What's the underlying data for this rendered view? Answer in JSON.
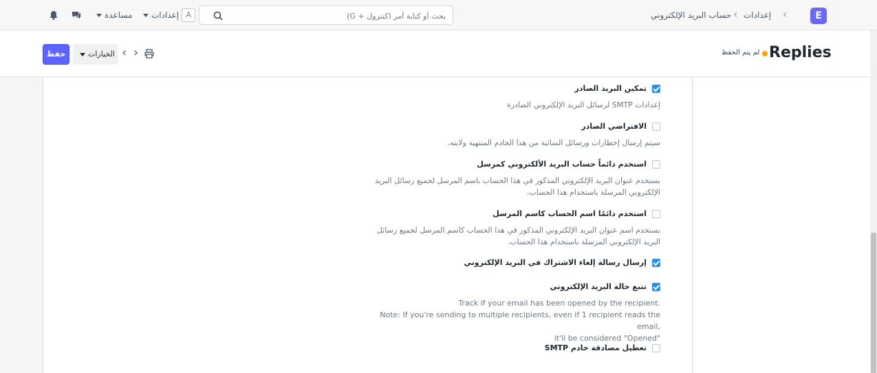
{
  "topbar": {
    "brand_letter": "E",
    "breadcrumb": [
      "إعدادات",
      "حساب البريد الإلكتروني"
    ],
    "search_placeholder": "بحث أو كتابة أمر (كنترول + G)",
    "settings_label": "إعدادات",
    "avatar_letter": "A",
    "help_label": "مساعدة",
    "icons": [
      "bell-icon",
      "chat-icon",
      "search-icon"
    ]
  },
  "pagehead": {
    "title": "Replies",
    "status": "لم يتم الحفظ",
    "status_color": "#ffa00a",
    "save_label": "حفظ",
    "options_label": "الخيارات"
  },
  "fields": [
    {
      "label": "تمكين البريد الصادر",
      "checked": true,
      "description": "إعدادات SMTP لرسائل البريد الإلكتروني الصادرة"
    },
    {
      "label": "الافتراضي الصادر",
      "checked": false,
      "description": "سيتم إرسال إخطارات ورسائل السائبة من هذا الخادم المنتهية ولايته."
    },
    {
      "label": "استخدم دائماً حساب البريد الألكتروني كمرسل",
      "checked": false,
      "description": "يستخدم عنوان البريد الإلكتروني المذكور في هذا الحساب باسم المرسل لجميع رسائل البريد الإلكتروني المرسلة باستخدام هذا الحساب."
    },
    {
      "label": "استخدم دائمًا اسم الحساب كاسم المرسل",
      "checked": false,
      "description": "يستخدم اسم عنوان البريد الإلكتروني المذكور في هذا الحساب كاسم المرسل لجميع رسائل البريد الإلكتروني المرسلة باستخدام هذا الحساب."
    },
    {
      "label": "إرسال رسالة إلغاء الاشتراك في البريد الإلكتروني",
      "checked": true,
      "description": ""
    },
    {
      "label": "تتبع حالة البريد الإلكتروني",
      "checked": true,
      "description_lines": [
        "Track if your email has been opened by the recipient.",
        "Note: If you're sending to multiple recipients, even if 1 recipient reads the email,",
        "it'll be considered \"Opened\""
      ]
    },
    {
      "label": "تعطيل مصادقة خادم SMTP",
      "checked": false,
      "description": ""
    }
  ],
  "colors": {
    "accent": "#5e64ff",
    "checkbox": "#2490ef"
  }
}
